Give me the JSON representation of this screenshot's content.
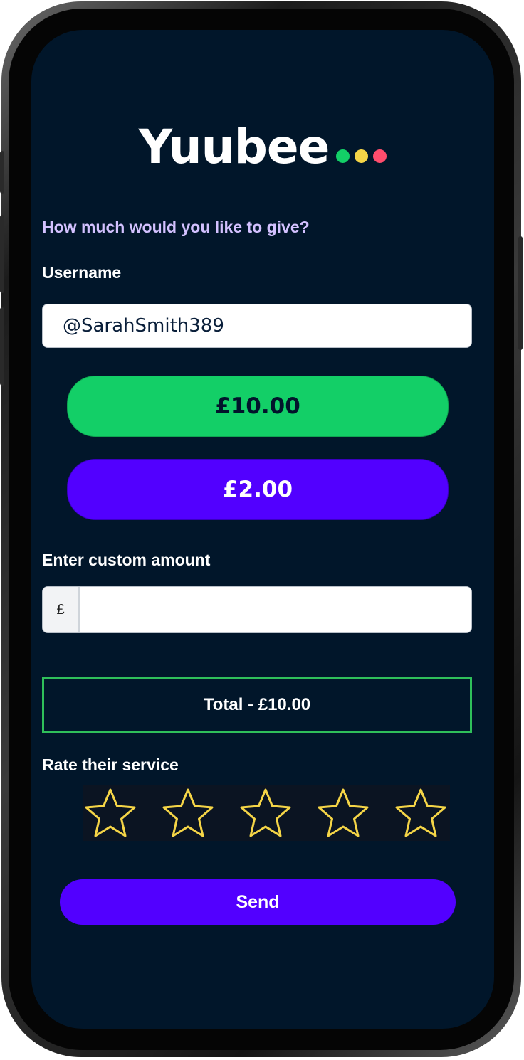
{
  "app": {
    "logo_text": "Yuubee",
    "logo_dot_colors": [
      "#13cf67",
      "#f5d547",
      "#ff4d6d"
    ]
  },
  "form": {
    "heading": "How much would you like to give?",
    "username_label": "Username",
    "username_value": "@SarahSmith389",
    "amount_options": [
      "£10.00",
      "£2.00"
    ],
    "selected_amount": "£10.00",
    "custom_amount_label": "Enter custom amount",
    "currency_symbol": "£",
    "custom_amount_value": "",
    "total_text": "Total - £10.00"
  },
  "rating": {
    "label": "Rate their service",
    "max_stars": 5,
    "selected_stars": 0
  },
  "actions": {
    "send_label": "Send"
  },
  "colors": {
    "background": "#01162a",
    "accent_purple": "#5200ff",
    "accent_green": "#13cf67",
    "heading_lilac": "#d3c1ff",
    "star_outline": "#f5d547",
    "total_border": "#2fbf5a"
  }
}
